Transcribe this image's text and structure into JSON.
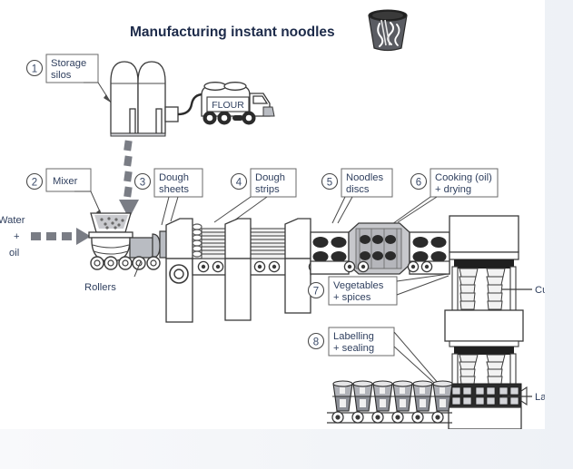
{
  "page": {
    "background_color": "#f4f6f9",
    "card_color": "#ffffff"
  },
  "diagram": {
    "title": "Manufacturing instant noodles",
    "title_color": "#1d2b4a",
    "label_color": "#2f3f5e",
    "icon": "noodle-cup-icon",
    "steps": [
      {
        "number": "1",
        "label_line1": "Storage",
        "label_line2": "silos"
      },
      {
        "number": "2",
        "label_line1": "Mixer",
        "label_line2": ""
      },
      {
        "number": "3",
        "label_line1": "Dough",
        "label_line2": "sheets"
      },
      {
        "number": "4",
        "label_line1": "Dough",
        "label_line2": "strips"
      },
      {
        "number": "5",
        "label_line1": "Noodles",
        "label_line2": "discs"
      },
      {
        "number": "6",
        "label_line1": "Cooking (oil)",
        "label_line2": "+ drying"
      },
      {
        "number": "7",
        "label_line1": "Vegetables",
        "label_line2": "+ spices"
      },
      {
        "number": "8",
        "label_line1": "Labelling",
        "label_line2": "+ sealing"
      }
    ],
    "annotations": {
      "truck_text": "FLOUR",
      "input_line1": "Water",
      "input_line2": "+",
      "input_line3": "oil",
      "rollers": "Rollers",
      "cups": "Cups",
      "labels": "Labels"
    }
  }
}
